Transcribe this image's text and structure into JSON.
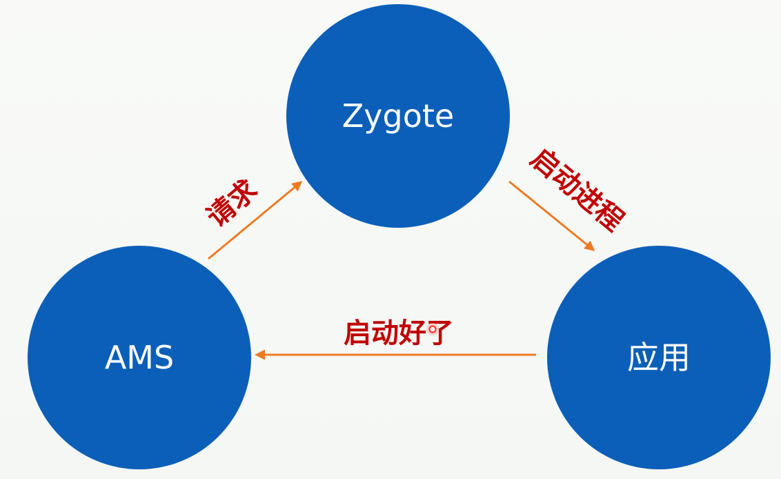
{
  "colors": {
    "node_fill": "#0b5fb8",
    "arrow": "#ee7a22",
    "edge_label": "#c00000",
    "node_text": "#ffffff"
  },
  "nodes": {
    "zygote": {
      "label": "Zygote"
    },
    "ams": {
      "label": "AMS"
    },
    "app": {
      "label": "应用"
    }
  },
  "edges": {
    "request": {
      "label": "请求"
    },
    "start_process": {
      "label": "启动进程"
    },
    "started": {
      "label": "启动好了"
    }
  }
}
